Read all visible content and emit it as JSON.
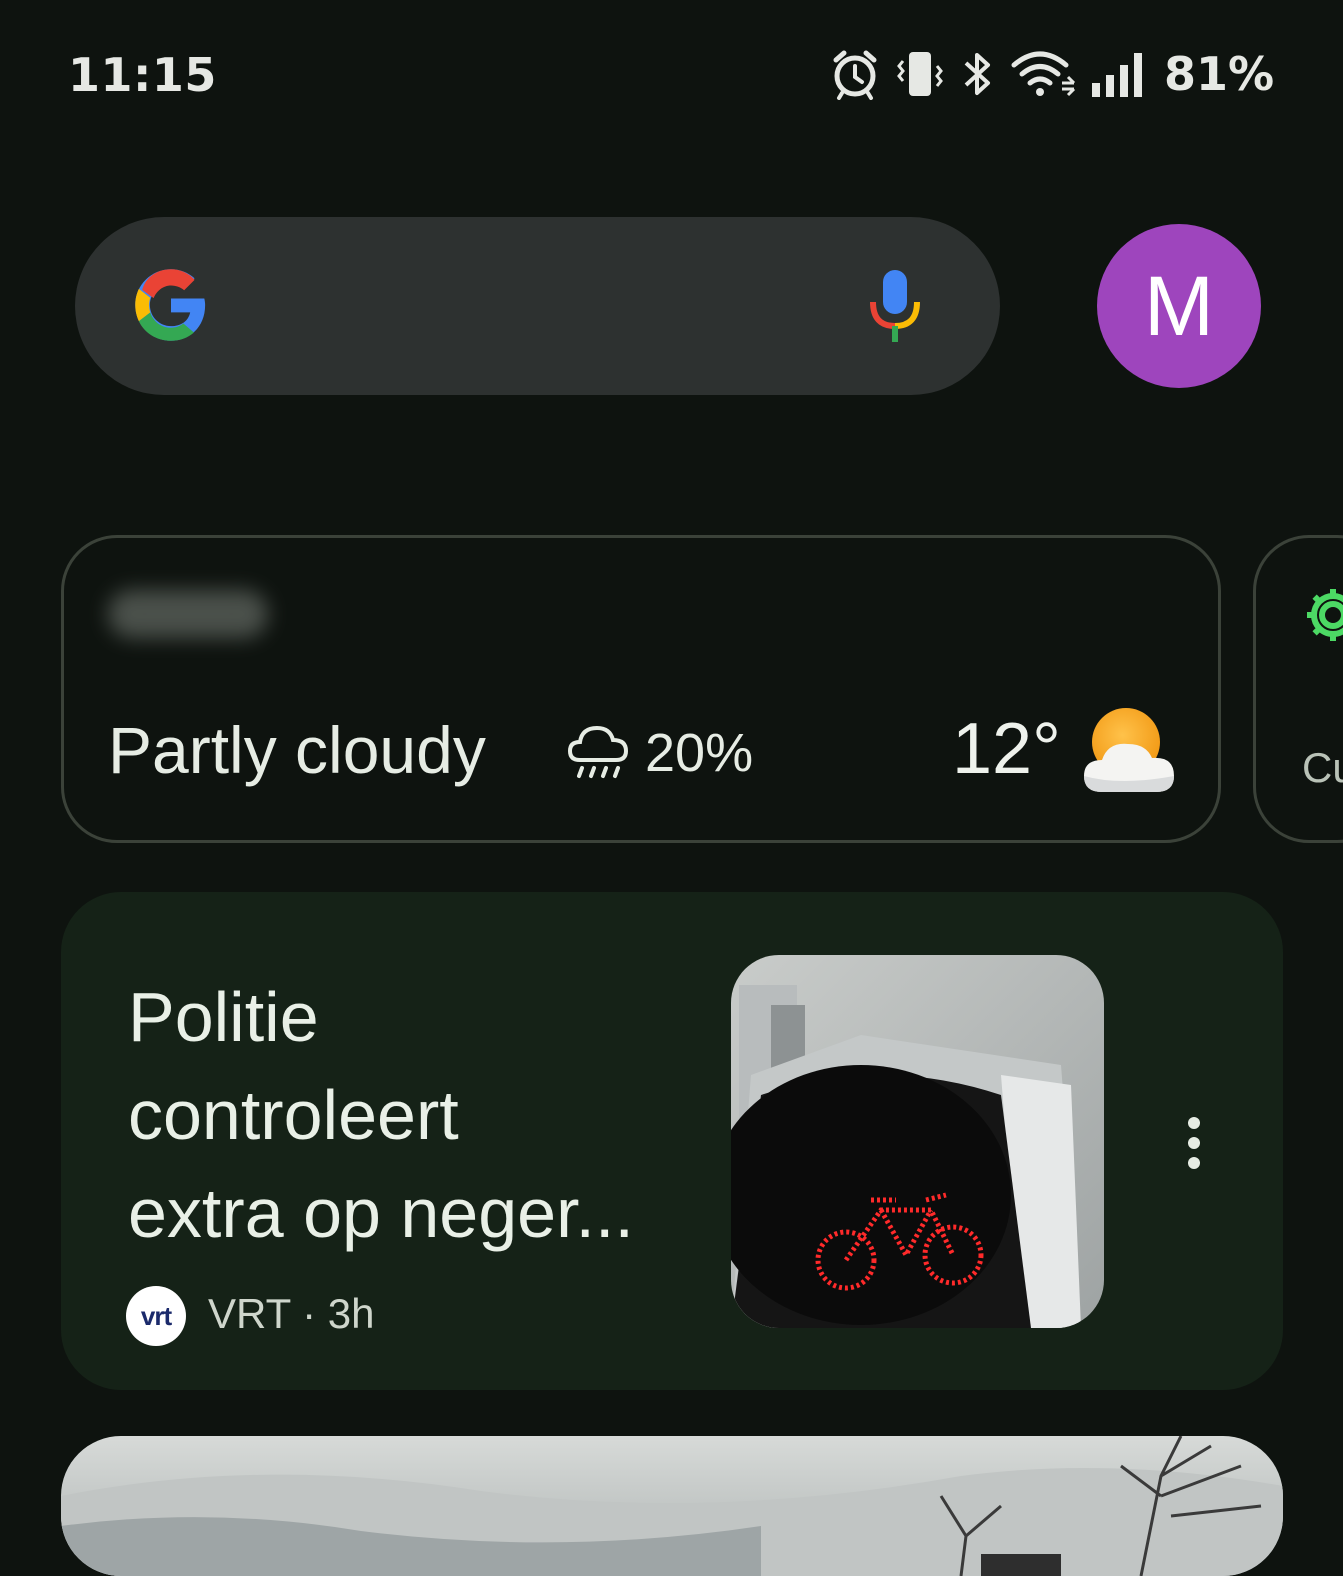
{
  "status_bar": {
    "time": "11:15",
    "battery": "81%",
    "icons": [
      "alarm-icon",
      "vibrate-icon",
      "bluetooth-icon",
      "wifi-icon",
      "signal-icon"
    ]
  },
  "search": {
    "logo": "google-g-icon",
    "mic": "mic-icon",
    "avatar_letter": "M",
    "avatar_color": "#9e45bd"
  },
  "weather": {
    "condition": "Partly cloudy",
    "precipitation": "20%",
    "temperature": "12°",
    "icon": "partly-cloudy-icon",
    "precip_icon": "rain-cloud-icon"
  },
  "side_card": {
    "icon": "gear-icon",
    "label_partial": "Cu"
  },
  "news": {
    "headline_lines": [
      "Politie",
      "controleert",
      "extra op neger..."
    ],
    "source_logo": "vrt",
    "source": "VRT · 3h"
  }
}
